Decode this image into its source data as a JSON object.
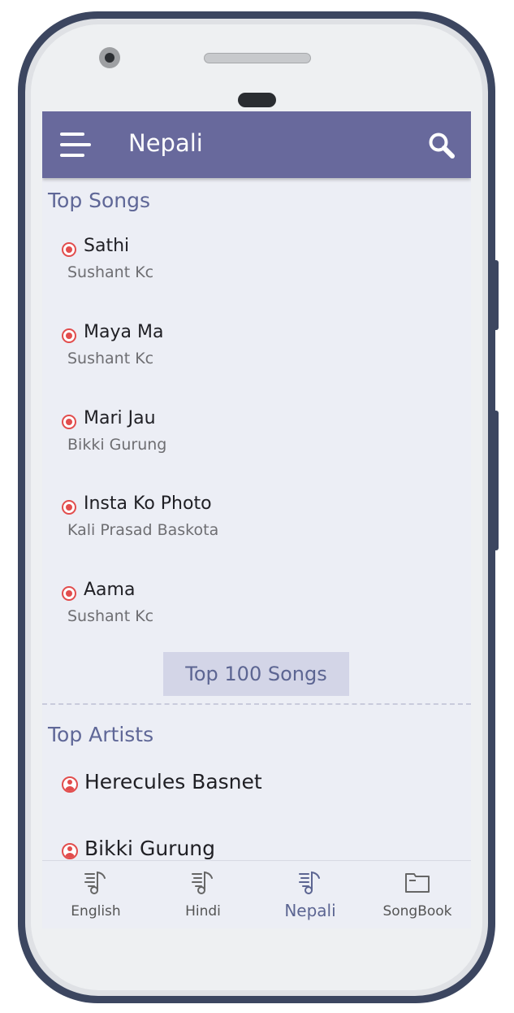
{
  "app_bar": {
    "title": "Nepali",
    "menu_icon": "hamburger-menu-icon",
    "search_icon": "search-icon"
  },
  "top_songs": {
    "title": "Top Songs",
    "items": [
      {
        "title": "Sathi",
        "artist": "Sushant Kc"
      },
      {
        "title": "Maya Ma",
        "artist": "Sushant Kc"
      },
      {
        "title": "Mari Jau",
        "artist": "Bikki Gurung"
      },
      {
        "title": "Insta Ko Photo",
        "artist": "Kali Prasad Baskota"
      },
      {
        "title": "Aama",
        "artist": "Sushant Kc"
      }
    ],
    "button_label": "Top 100 Songs"
  },
  "top_artists": {
    "title": "Top Artists",
    "items": [
      {
        "name": "Herecules Basnet"
      },
      {
        "name": "Bikki Gurung"
      }
    ]
  },
  "bottom_nav": {
    "items": [
      {
        "label": "English",
        "icon": "music-list-icon",
        "active": false
      },
      {
        "label": "Hindi",
        "icon": "music-list-icon",
        "active": false
      },
      {
        "label": "Nepali",
        "icon": "music-list-icon",
        "active": true
      },
      {
        "label": "SongBook",
        "icon": "folder-icon",
        "active": false
      }
    ]
  },
  "colors": {
    "app_bar": "#68699c",
    "accent": "#5f6797",
    "record_icon": "#e24d4d",
    "background": "#eceef5"
  }
}
